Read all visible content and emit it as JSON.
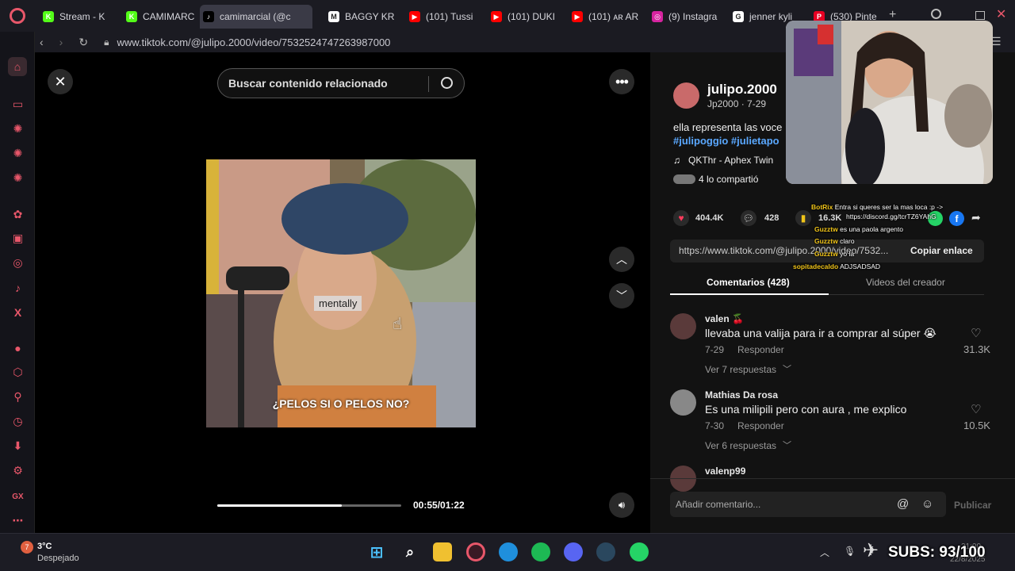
{
  "browser": {
    "tabs": [
      {
        "label": "Stream - K",
        "icon": "kick-icon",
        "color": "#53fc18",
        "glyph": "K"
      },
      {
        "label": "CAMIMARC",
        "icon": "kick-icon",
        "color": "#53fc18",
        "glyph": "K"
      },
      {
        "label": "camimarcial (@c",
        "icon": "tiktok-icon",
        "color": "#000000",
        "glyph": "♪",
        "active": true
      },
      {
        "label": "BAGGY KR",
        "icon": "m-icon",
        "color": "#ffffff",
        "glyph": "M"
      },
      {
        "label": "(101) Tussi",
        "icon": "youtube-icon",
        "color": "#ff0000",
        "glyph": "▶"
      },
      {
        "label": "(101) DUKI",
        "icon": "youtube-icon",
        "color": "#ff0000",
        "glyph": "▶"
      },
      {
        "label": "(101) ᴀʀ AR",
        "icon": "youtube-icon",
        "color": "#ff0000",
        "glyph": "▶"
      },
      {
        "label": "(9) Instagra",
        "icon": "instagram-icon",
        "color": "#d6249f",
        "glyph": "◎"
      },
      {
        "label": "jenner kyli",
        "icon": "google-icon",
        "color": "#ffffff",
        "glyph": "G"
      },
      {
        "label": "(530) Pinte",
        "icon": "pinterest-icon",
        "color": "#e60023",
        "glyph": "P"
      }
    ],
    "url": "www.tiktok.com/@julipo.2000/video/7532524747263987000"
  },
  "video": {
    "search_placeholder": "Buscar contenido relacionado",
    "caption_word": "mentally",
    "subtitle": "¿PELOS SI O PELOS NO?",
    "time": "00:55/01:22",
    "progress": 0.677
  },
  "post": {
    "username": "julipo.2000",
    "handle_date": "Jp2000 · 7-29",
    "description": "ella representa las voce",
    "hashtags": "#julipoggio #julietapo",
    "music": "QKThr - Aphex Twin",
    "shared": "4 lo compartió",
    "likes": "404.4K",
    "comments": "428",
    "saves": "16.3K",
    "link": "https://www.tiktok.com/@julipo.2000/video/7532...",
    "copy_link": "Copiar enlace",
    "tab_comments": "Comentarios (428)",
    "tab_creator": "Videos del creador",
    "add_comment_placeholder": "Añadir comentario...",
    "publish": "Publicar"
  },
  "comments": [
    {
      "name": "valen 🍒",
      "text": "llevaba una valija para ir a comprar al súper 😭",
      "date": "7-29",
      "reply": "Responder",
      "replies": "Ver 7 respuestas",
      "likes": "31.3K"
    },
    {
      "name": "Mathias Da rosa",
      "text": "Es una milipili pero con aura , me explico",
      "date": "7-30",
      "reply": "Responder",
      "replies": "Ver 6 respuestas",
      "likes": "10.5K"
    },
    {
      "name": "valenp99",
      "text": "",
      "date": "",
      "reply": "",
      "replies": "",
      "likes": ""
    }
  ],
  "chat": [
    {
      "user": "BotRix",
      "msg": "Entra si queres ser la mas loca :p ->"
    },
    {
      "user": "",
      "msg": "https://discord.gg/tcrTZ6YAhG"
    },
    {
      "user": "Guzztw",
      "msg": "es una paola argento"
    },
    {
      "user": "Guzztw",
      "msg": "claro"
    },
    {
      "user": "Guzztw",
      "msg": "yo la"
    },
    {
      "user": "sopitadecaldo",
      "msg": "ADJSADSAD"
    }
  ],
  "taskbar": {
    "weather_temp": "3°C",
    "weather_desc": "Despejado",
    "subs": "SUBS: 93/100",
    "clock_time": "21:00",
    "clock_date": "22/8/2025"
  }
}
